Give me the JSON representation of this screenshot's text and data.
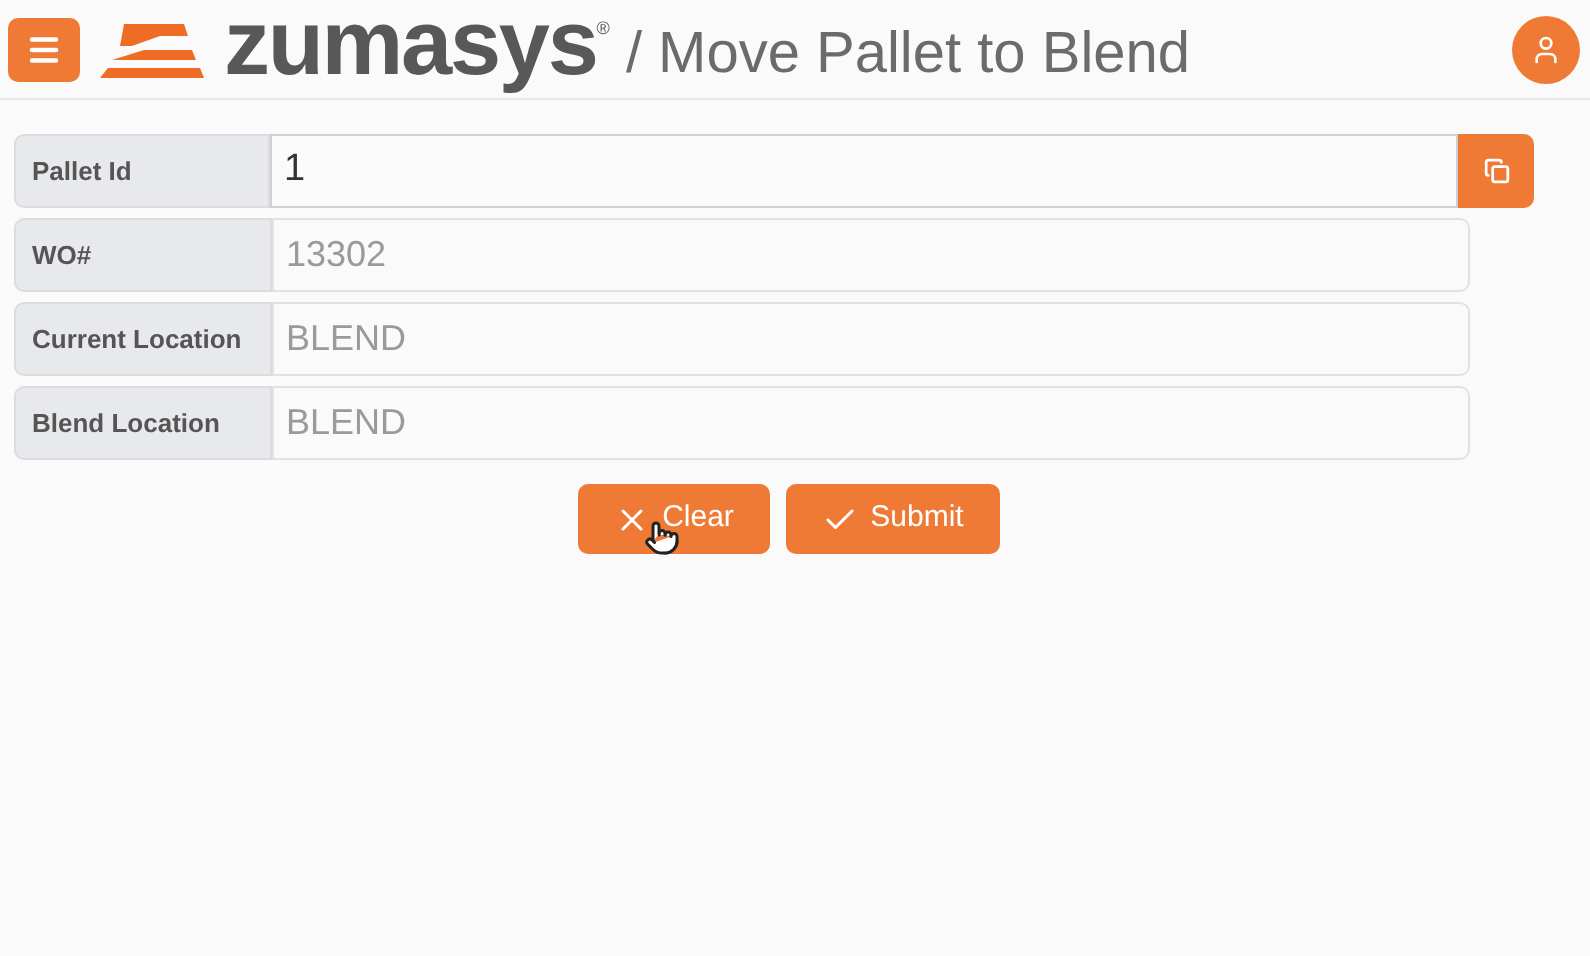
{
  "header": {
    "logo_text": "zumasys",
    "logo_mark": "®",
    "title": "/ Move Pallet to Blend"
  },
  "fields": [
    {
      "label": "Pallet Id",
      "value": "1",
      "disabled": false,
      "has_action": true
    },
    {
      "label": "WO#",
      "value": "13302",
      "disabled": true,
      "has_action": false
    },
    {
      "label": "Current Location",
      "value": "BLEND",
      "disabled": true,
      "has_action": false
    },
    {
      "label": "Blend Location",
      "value": "BLEND",
      "disabled": true,
      "has_action": false
    }
  ],
  "buttons": [
    {
      "kind": "clear",
      "label": "Clear"
    },
    {
      "kind": "submit",
      "label": "Submit"
    }
  ]
}
